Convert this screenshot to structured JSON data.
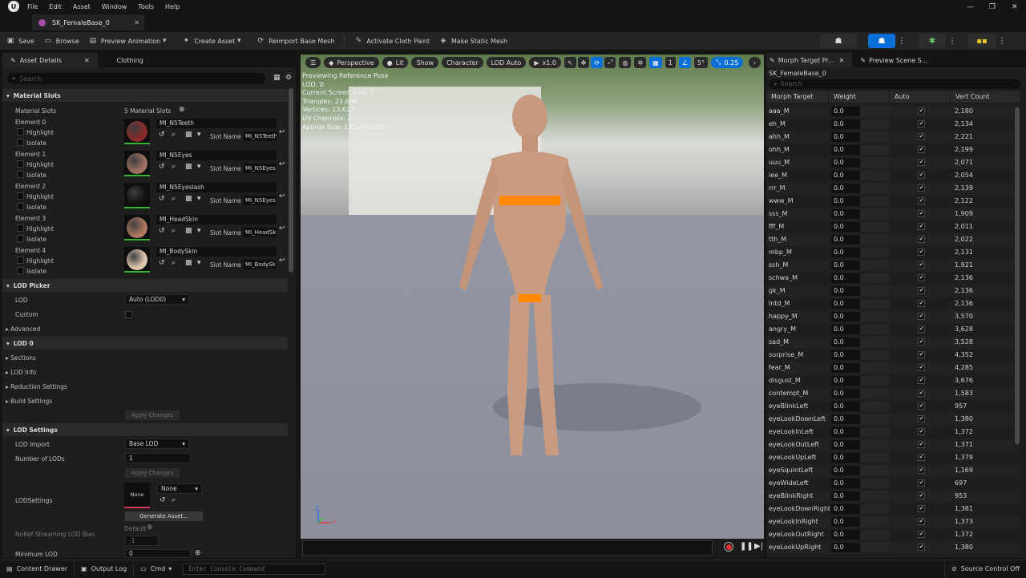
{
  "menu": {
    "items": [
      "File",
      "Edit",
      "Asset",
      "Window",
      "Tools",
      "Help"
    ]
  },
  "document_tab": {
    "title": "SK_FemaleBase_0"
  },
  "window_controls": {
    "minimize": "—",
    "maximize": "❐",
    "close": "✕"
  },
  "toolbar": {
    "save": "Save",
    "browse": "Browse",
    "preview_animation": "Preview Animation",
    "create_asset": "Create Asset",
    "reimport": "Reimport Base Mesh",
    "cloth_paint": "Activate Cloth Paint",
    "static_mesh": "Make Static Mesh"
  },
  "left_panel": {
    "tabs": [
      "Asset Details",
      "Clothing"
    ],
    "search_placeholder": "Search",
    "material_slots_header": "Material Slots",
    "material_slots_label": "Material Slots",
    "material_slots_count": "5 Material Slots",
    "highlight": "Highlight",
    "isolate": "Isolate",
    "slot_name_label": "Slot Name",
    "elements": [
      {
        "label": "Element 0",
        "material": "MI_N5Teeth",
        "slot": "MI_N5Teeth",
        "thumb": "#8a2a2a"
      },
      {
        "label": "Element 1",
        "material": "MI_N5Eyes",
        "slot": "MI_N5Eyes",
        "thumb": "#9c7060"
      },
      {
        "label": "Element 2",
        "material": "MI_N5Eyeslash",
        "slot": "MI_N5Eyes",
        "thumb": "#121212"
      },
      {
        "label": "Element 3",
        "material": "MI_HeadSkin",
        "slot": "MI_HeadSk",
        "thumb": "#b07860"
      },
      {
        "label": "Element 4",
        "material": "MI_BodySkin",
        "slot": "MI_BodySk",
        "thumb": "#e0c8b0"
      }
    ],
    "lod_picker_header": "LOD Picker",
    "lod_label": "LOD",
    "lod_value": "Auto (LOD0)",
    "custom_label": "Custom",
    "advanced_label": "Advanced",
    "lod0_header": "LOD 0",
    "sections_label": "Sections",
    "lod_info_label": "LOD Info",
    "reduction_label": "Reduction Settings",
    "build_label": "Build Settings",
    "apply_changes": "Apply Changes",
    "lod_settings_header": "LOD Settings",
    "lod_import_label": "LOD Import",
    "lod_import_value": "Base LOD",
    "num_lods_label": "Number of LODs",
    "num_lods_value": "1",
    "lodsettings_label": "LODSettings",
    "none_thumb": "None",
    "none_value": "None",
    "generate_asset": "Generate Asset...",
    "noref_label": "NoRef Streaming LOD Bias",
    "default_label": "Default",
    "noref_value": "-1",
    "min_lod_label": "Minimum LOD",
    "min_lod_value": "0"
  },
  "viewport": {
    "perspective": "Perspective",
    "lit": "Lit",
    "show": "Show",
    "character": "Character",
    "lod_auto": "LOD Auto",
    "play_speed": "x1.0",
    "one": "1",
    "angle": "5°",
    "speed": "0.25",
    "stats": [
      "Previewing Reference Pose",
      "LOD: 0",
      "Current Screen Size: 1",
      "Triangles: 23,686",
      "Vertices: 13,627",
      "UV Channels: 2",
      "Approx Size: 121x45x180"
    ],
    "axis_z": "Z",
    "axis_x": "X"
  },
  "right_panel": {
    "tabs": [
      "Morph Target Pr...",
      "Preview Scene S..."
    ],
    "asset_name": "SK_FemaleBase_0",
    "search_placeholder": "Search",
    "columns": [
      "Morph Target Nam",
      "Weight",
      "Auto",
      "Vert Count"
    ],
    "check": "✔",
    "rows": [
      {
        "name": "aaa_M",
        "weight": "0.0",
        "verts": "2,180"
      },
      {
        "name": "eh_M",
        "weight": "0.0",
        "verts": "2,134"
      },
      {
        "name": "ahh_M",
        "weight": "0.0",
        "verts": "2,221"
      },
      {
        "name": "ohh_M",
        "weight": "0.0",
        "verts": "2,199"
      },
      {
        "name": "uuu_M",
        "weight": "0.0",
        "verts": "2,071"
      },
      {
        "name": "iee_M",
        "weight": "0.0",
        "verts": "2,054"
      },
      {
        "name": "rrr_M",
        "weight": "0.0",
        "verts": "2,139"
      },
      {
        "name": "www_M",
        "weight": "0.0",
        "verts": "2,122"
      },
      {
        "name": "sss_M",
        "weight": "0.0",
        "verts": "1,909"
      },
      {
        "name": "fff_M",
        "weight": "0.0",
        "verts": "2,011"
      },
      {
        "name": "tth_M",
        "weight": "0.0",
        "verts": "2,022"
      },
      {
        "name": "mbp_M",
        "weight": "0.0",
        "verts": "2,131"
      },
      {
        "name": "ssh_M",
        "weight": "0.0",
        "verts": "1,921"
      },
      {
        "name": "schwa_M",
        "weight": "0.0",
        "verts": "2,136"
      },
      {
        "name": "gk_M",
        "weight": "0.0",
        "verts": "2,136"
      },
      {
        "name": "lntd_M",
        "weight": "0.0",
        "verts": "2,136"
      },
      {
        "name": "happy_M",
        "weight": "0.0",
        "verts": "3,570"
      },
      {
        "name": "angry_M",
        "weight": "0.0",
        "verts": "3,628"
      },
      {
        "name": "sad_M",
        "weight": "0.0",
        "verts": "3,528"
      },
      {
        "name": "surprise_M",
        "weight": "0.0",
        "verts": "4,352"
      },
      {
        "name": "fear_M",
        "weight": "0.0",
        "verts": "4,285"
      },
      {
        "name": "disgust_M",
        "weight": "0.0",
        "verts": "3,676"
      },
      {
        "name": "contempt_M",
        "weight": "0.0",
        "verts": "1,583"
      },
      {
        "name": "eyeBlinkLeft",
        "weight": "0.0",
        "verts": "957"
      },
      {
        "name": "eyeLookDownLeft",
        "weight": "0.0",
        "verts": "1,380"
      },
      {
        "name": "eyeLookInLeft",
        "weight": "0.0",
        "verts": "1,372"
      },
      {
        "name": "eyeLookOutLeft",
        "weight": "0.0",
        "verts": "1,371"
      },
      {
        "name": "eyeLookUpLeft",
        "weight": "0.0",
        "verts": "1,379"
      },
      {
        "name": "eyeSquintLeft",
        "weight": "0.0",
        "verts": "1,169"
      },
      {
        "name": "eyeWideLeft",
        "weight": "0.0",
        "verts": "697"
      },
      {
        "name": "eyeBlinkRight",
        "weight": "0.0",
        "verts": "953"
      },
      {
        "name": "eyeLookDownRight",
        "weight": "0.0",
        "verts": "1,381"
      },
      {
        "name": "eyeLookInRight",
        "weight": "0.0",
        "verts": "1,373"
      },
      {
        "name": "eyeLookOutRight",
        "weight": "0.0",
        "verts": "1,372"
      },
      {
        "name": "eyeLookUpRight",
        "weight": "0.0",
        "verts": "1,380"
      }
    ]
  },
  "statusbar": {
    "content_drawer": "Content Drawer",
    "output_log": "Output Log",
    "cmd": "Cmd",
    "console_placeholder": "Enter Console Command",
    "source_control": "Source Control Off"
  },
  "colors": {
    "accent": "#0a6fd6",
    "censor": "#ff8a00",
    "valid": "#2fb82f"
  }
}
